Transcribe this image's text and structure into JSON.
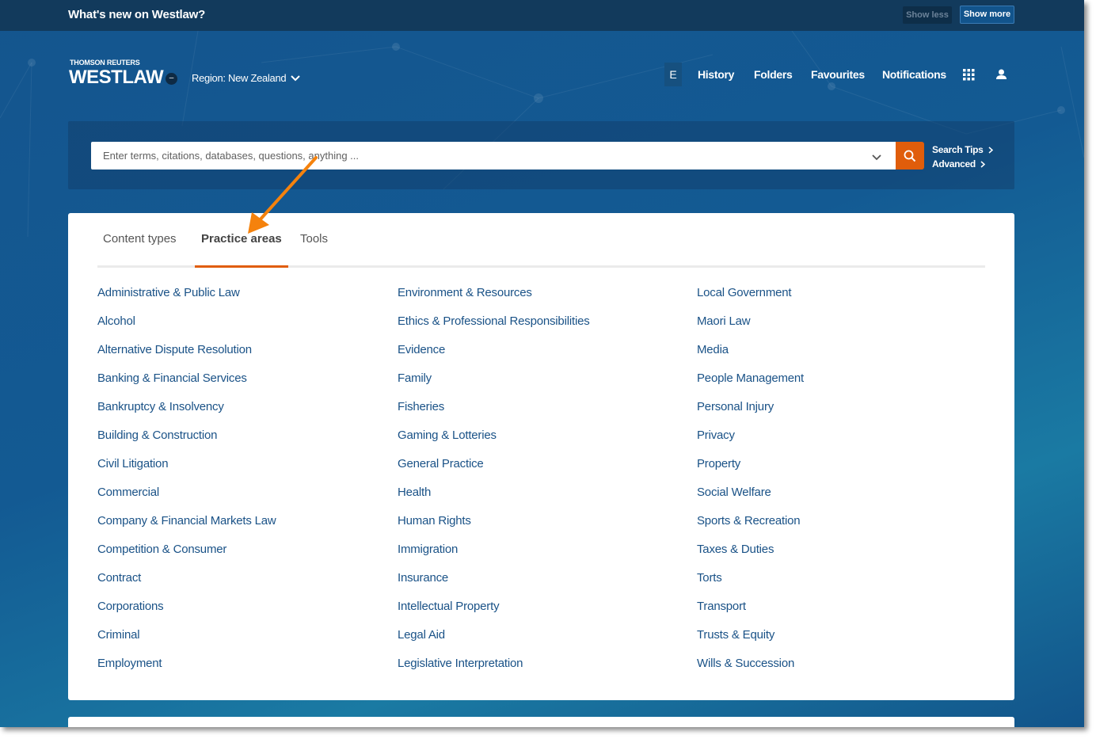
{
  "banner": {
    "title": "What's new on Westlaw?",
    "show_less_label": "Show less",
    "show_more_label": "Show more"
  },
  "brand": {
    "company": "THOMSON REUTERS",
    "product": "WESTLAW",
    "toggle_icon": "minus-icon"
  },
  "region": {
    "label": "Region: New Zealand",
    "icon": "chevron-down-icon"
  },
  "nav": {
    "user_initial": "E",
    "items": [
      {
        "label": "History"
      },
      {
        "label": "Folders"
      },
      {
        "label": "Favourites"
      },
      {
        "label": "Notifications"
      }
    ],
    "apps_icon": "grid-icon",
    "user_icon": "person-icon"
  },
  "search": {
    "placeholder": "Enter terms, citations, databases, questions, anything ...",
    "value": "",
    "dropdown_icon": "chevron-down-icon",
    "button_icon": "search-icon",
    "links": [
      {
        "label": "Search Tips"
      },
      {
        "label": "Advanced"
      }
    ]
  },
  "tabs": [
    {
      "label": "Content types",
      "active": false
    },
    {
      "label": "Practice areas",
      "active": true
    },
    {
      "label": "Tools",
      "active": false
    }
  ],
  "practice_areas": {
    "columns": [
      [
        "Administrative & Public Law",
        "Alcohol",
        "Alternative Dispute Resolution",
        "Banking & Financial Services",
        "Bankruptcy & Insolvency",
        "Building & Construction",
        "Civil Litigation",
        "Commercial",
        "Company & Financial Markets Law",
        "Competition & Consumer",
        "Contract",
        "Corporations",
        "Criminal",
        "Employment"
      ],
      [
        "Environment & Resources",
        "Ethics & Professional Responsibilities",
        "Evidence",
        "Family",
        "Fisheries",
        "Gaming & Lotteries",
        "General Practice",
        "Health",
        "Human Rights",
        "Immigration",
        "Insurance",
        "Intellectual Property",
        "Legal Aid",
        "Legislative Interpretation"
      ],
      [
        "Local Government",
        "Maori Law",
        "Media",
        "People Management",
        "Personal Injury",
        "Privacy",
        "Property",
        "Social Welfare",
        "Sports & Recreation",
        "Taxes & Duties",
        "Torts",
        "Transport",
        "Trusts & Equity",
        "Wills & Succession"
      ]
    ]
  },
  "colors": {
    "banner_bg": "#123a5c",
    "header_bg": "#14558e",
    "accent_orange": "#e05d0b",
    "link_blue": "#1a5287",
    "annotation_arrow": "#f5820d"
  }
}
